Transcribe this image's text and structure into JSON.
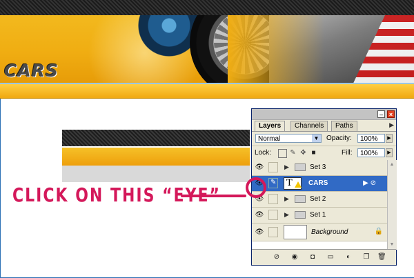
{
  "header": {
    "logo_text": "CARS"
  },
  "annotation": {
    "callout_text": "CLICK ON THIS “EYE”",
    "color": "#d4185a"
  },
  "panel": {
    "tabs": [
      {
        "label": "Layers",
        "active": true
      },
      {
        "label": "Channels",
        "active": false
      },
      {
        "label": "Paths",
        "active": false
      }
    ],
    "blend_mode": "Normal",
    "opacity_label": "Opacity:",
    "opacity_value": "100%",
    "lock_label": "Lock:",
    "fill_label": "Fill:",
    "fill_value": "100%",
    "layers": [
      {
        "name": "Set 3",
        "type": "group",
        "visible": true
      },
      {
        "name": "CARS",
        "type": "text",
        "visible": false,
        "selected": true
      },
      {
        "name": "Set 2",
        "type": "group",
        "visible": true
      },
      {
        "name": "Set 1",
        "type": "group",
        "visible": true
      },
      {
        "name": "Background",
        "type": "background",
        "visible": true,
        "locked": true
      }
    ],
    "icons": [
      "link-layers-icon",
      "layer-style-icon",
      "layer-mask-icon",
      "new-group-icon",
      "adjustment-layer-icon",
      "new-layer-icon",
      "trash-icon"
    ]
  },
  "colors": {
    "accent_yellow": "#f0ad12",
    "selection_blue": "#316ac5"
  }
}
